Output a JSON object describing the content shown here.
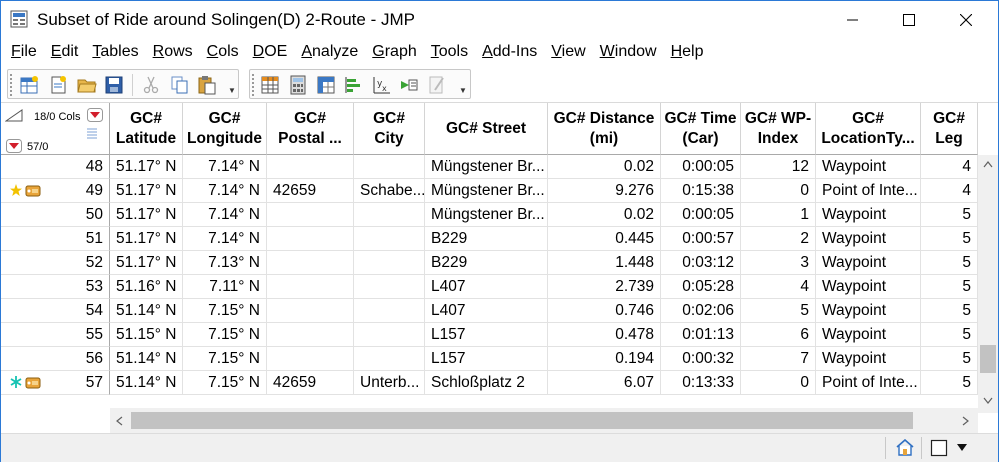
{
  "window": {
    "title": "Subset of Ride around Solingen(D) 2-Route - JMP"
  },
  "menu": [
    "File",
    "Edit",
    "Tables",
    "Rows",
    "Cols",
    "DOE",
    "Analyze",
    "Graph",
    "Tools",
    "Add-Ins",
    "View",
    "Window",
    "Help"
  ],
  "corner": {
    "cols_label": "18/0 Cols",
    "rows_label": "57/0"
  },
  "columns": [
    {
      "line1": "GC#",
      "line2": "Latitude"
    },
    {
      "line1": "GC#",
      "line2": "Longitude"
    },
    {
      "line1": "GC#",
      "line2": "Postal ..."
    },
    {
      "line1": "GC#",
      "line2": "City"
    },
    {
      "line1": "",
      "line2": "GC# Street"
    },
    {
      "line1": "GC# Distance",
      "line2": "(mi)"
    },
    {
      "line1": "GC# Time",
      "line2": "(Car)"
    },
    {
      "line1": "GC# WP-",
      "line2": "Index"
    },
    {
      "line1": "GC#",
      "line2": "LocationTy..."
    },
    {
      "line1": "GC#",
      "line2": "Leg"
    }
  ],
  "rows": [
    {
      "num": "48",
      "marker": "",
      "cells": [
        "51.17° N",
        "7.14° N",
        "",
        "",
        "Müngstener Br...",
        "0.02",
        "0:00:05",
        "12",
        "Waypoint",
        "4"
      ]
    },
    {
      "num": "49",
      "marker": "star-yellow",
      "cells": [
        "51.17° N",
        "7.14° N",
        "42659",
        "Schabe...",
        "Müngstener Br...",
        "9.276",
        "0:15:38",
        "0",
        "Point of Inte...",
        "4"
      ]
    },
    {
      "num": "50",
      "marker": "",
      "cells": [
        "51.17° N",
        "7.14° N",
        "",
        "",
        "Müngstener Br...",
        "0.02",
        "0:00:05",
        "1",
        "Waypoint",
        "5"
      ]
    },
    {
      "num": "51",
      "marker": "",
      "cells": [
        "51.17° N",
        "7.14° N",
        "",
        "",
        "B229",
        "0.445",
        "0:00:57",
        "2",
        "Waypoint",
        "5"
      ]
    },
    {
      "num": "52",
      "marker": "",
      "cells": [
        "51.17° N",
        "7.13° N",
        "",
        "",
        "B229",
        "1.448",
        "0:03:12",
        "3",
        "Waypoint",
        "5"
      ]
    },
    {
      "num": "53",
      "marker": "",
      "cells": [
        "51.16° N",
        "7.11° N",
        "",
        "",
        "L407",
        "2.739",
        "0:05:28",
        "4",
        "Waypoint",
        "5"
      ]
    },
    {
      "num": "54",
      "marker": "",
      "cells": [
        "51.14° N",
        "7.15° N",
        "",
        "",
        "L407",
        "0.746",
        "0:02:06",
        "5",
        "Waypoint",
        "5"
      ]
    },
    {
      "num": "55",
      "marker": "",
      "cells": [
        "51.15° N",
        "7.15° N",
        "",
        "",
        "L157",
        "0.478",
        "0:01:13",
        "6",
        "Waypoint",
        "5"
      ]
    },
    {
      "num": "56",
      "marker": "",
      "cells": [
        "51.14° N",
        "7.15° N",
        "",
        "",
        "L157",
        "0.194",
        "0:00:32",
        "7",
        "Waypoint",
        "5"
      ]
    },
    {
      "num": "57",
      "marker": "asterisk-cyan",
      "cells": [
        "51.14° N",
        "7.15° N",
        "42659",
        "Unterb...",
        "Schloßplatz 2",
        "6.07",
        "0:13:33",
        "0",
        "Point of Inte...",
        "5"
      ]
    }
  ],
  "colors": {
    "window_border": "#2b79d6",
    "accent_blue": "#1f6fd1",
    "star_yellow": "#f2c200",
    "asterisk_cyan": "#16c3b3",
    "tag_orange": "#e8a43a"
  }
}
